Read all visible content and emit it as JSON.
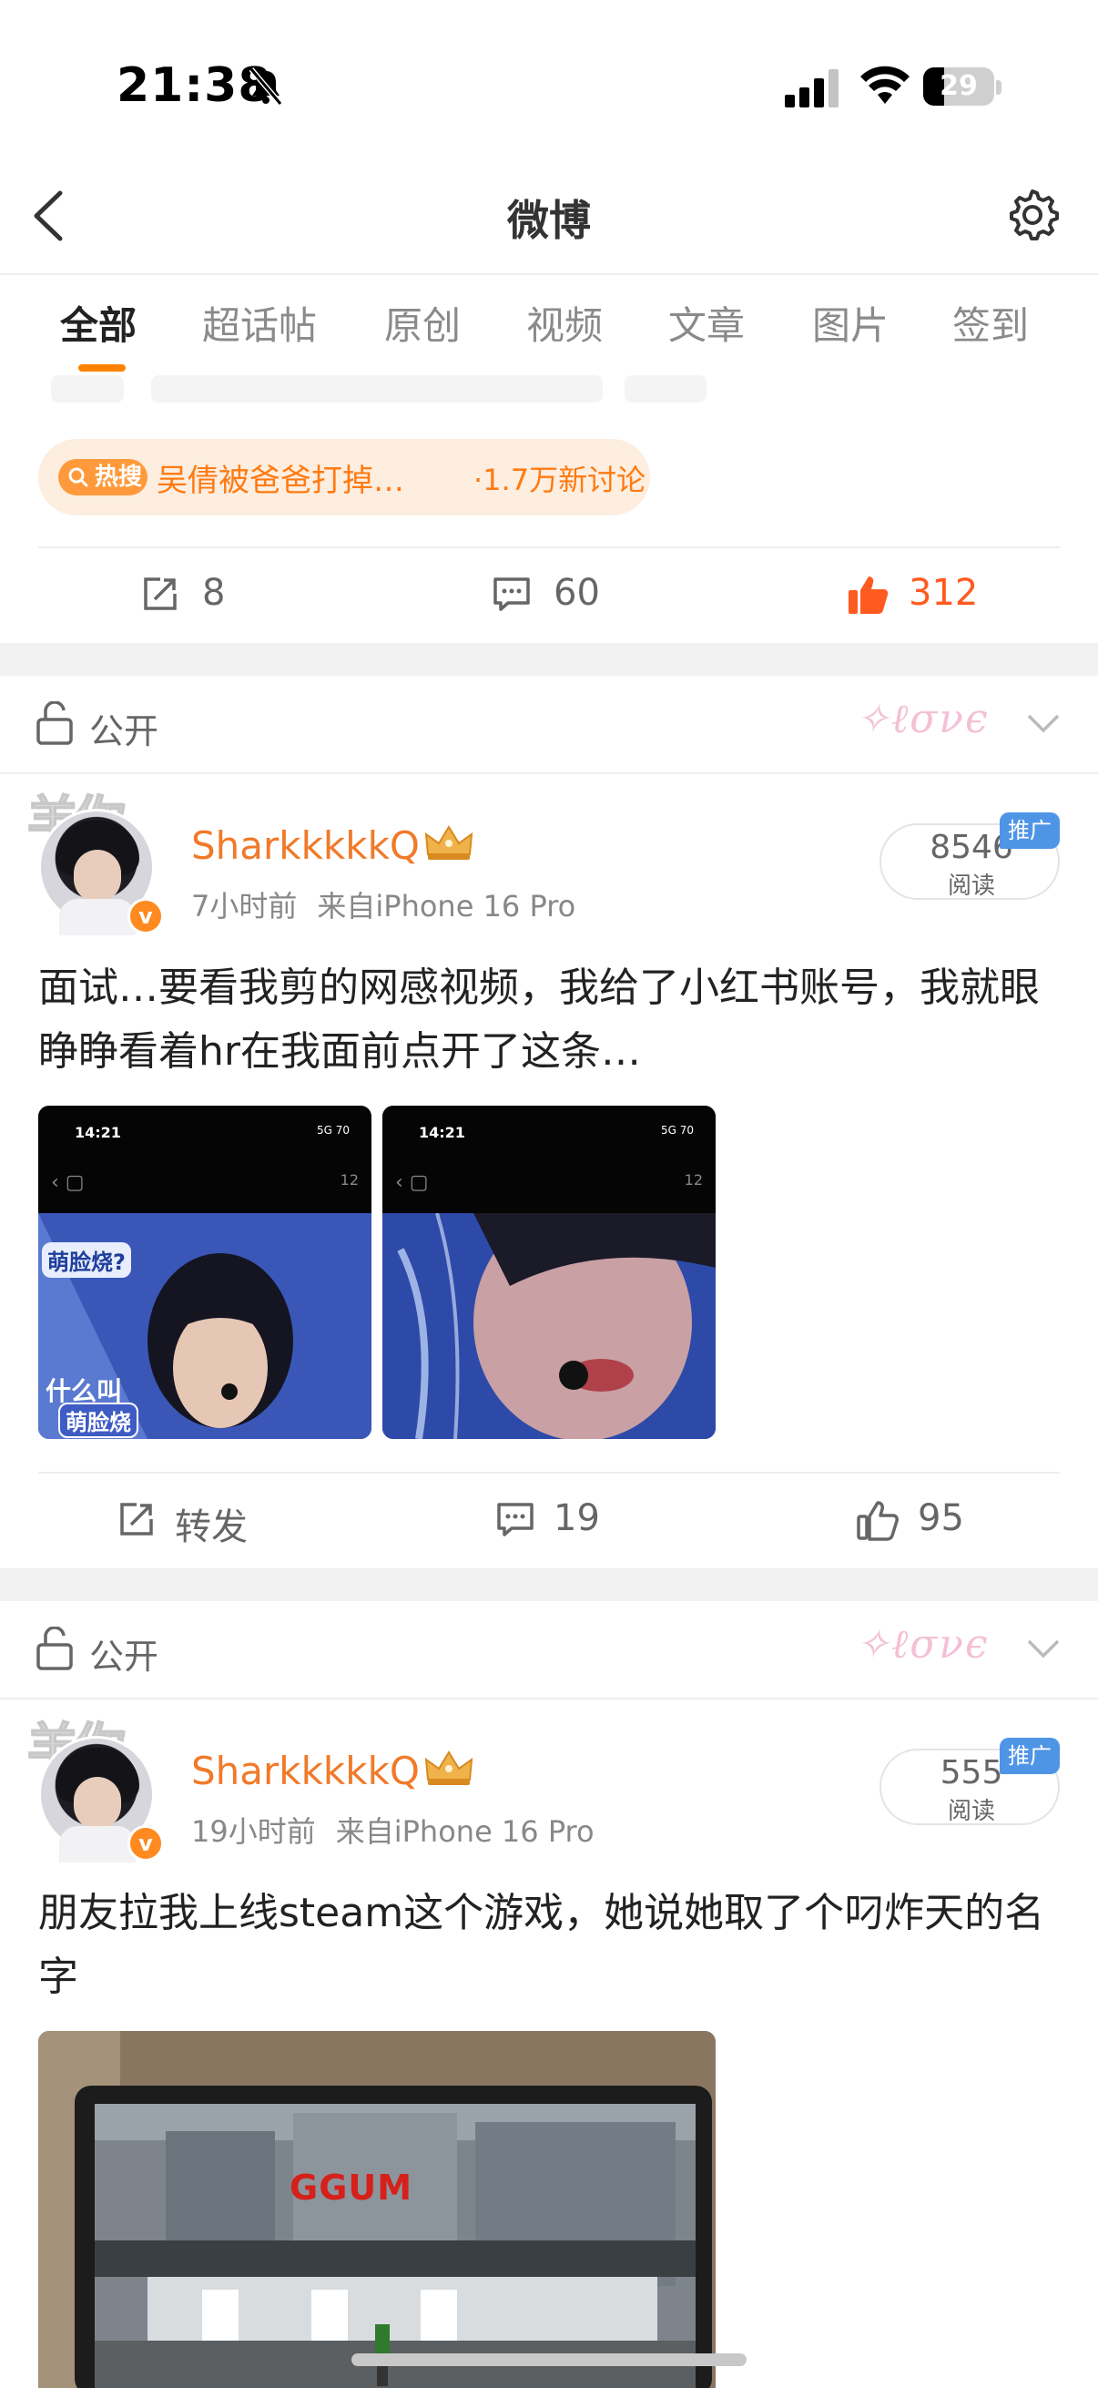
{
  "status_bar": {
    "time": "21:38",
    "battery": "29",
    "battery_level": 0.29
  },
  "nav": {
    "title": "微博"
  },
  "tabs": [
    "全部",
    "超话帖",
    "原创",
    "视频",
    "文章",
    "图片",
    "签到"
  ],
  "active_tab": 0,
  "hot_topic": {
    "badge": "热搜",
    "topic": "吴倩被爸爸打掉…",
    "count": "·1.7万新讨论"
  },
  "post0_actions": {
    "repost": "8",
    "comment": "60",
    "like": "312"
  },
  "posts": [
    {
      "visibility": "公开",
      "avatar_text": "羊你",
      "username": "SharkkkkkQ",
      "time": "7小时前",
      "source": "来自iPhone 16 Pro",
      "reads": "8546",
      "reads_label": "阅读",
      "ad_tag": "推广",
      "text": "面试…要看我剪的网感视频，我给了小红书账号，我就眼睁睁看着hr在我面前点开了这条…",
      "images": [
        {
          "status_time": "14:21",
          "status_right": "5G 70",
          "share_count": "12",
          "caption_top": "萌脸烧?",
          "caption_bottom1": "什么叫",
          "caption_bottom2": "萌脸烧"
        },
        {
          "status_time": "14:21",
          "status_right": "5G 70",
          "share_count": "12"
        }
      ],
      "actions": {
        "repost": "转发",
        "comment": "19",
        "like": "95"
      }
    },
    {
      "visibility": "公开",
      "avatar_text": "羊你",
      "username": "SharkkkkkQ",
      "time": "19小时前",
      "source": "来自iPhone 16 Pro",
      "reads": "555",
      "reads_label": "阅读",
      "ad_tag": "推广",
      "text": "朋友拉我上线steam这个游戏，她说她取了个叼炸天的名字",
      "image_logo": "GGUM"
    }
  ],
  "colors": {
    "accent": "#ff8200",
    "username": "#f07a2a",
    "like_active": "#ff5a1f",
    "ad_tag": "#4f95e6"
  }
}
